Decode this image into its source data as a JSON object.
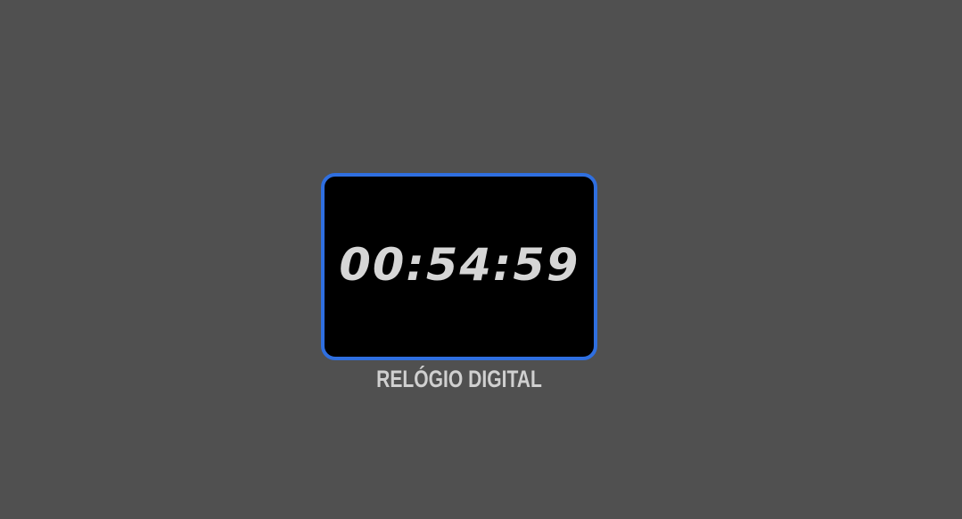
{
  "clock": {
    "time": "00:54:59",
    "caption": "RELÓGIO DIGITAL"
  },
  "colors": {
    "background": "#505050",
    "frame_border": "#2f6fe0",
    "display_background": "#000000",
    "time_text": "#d6d6d6",
    "caption_text": "#d0d0d0"
  }
}
